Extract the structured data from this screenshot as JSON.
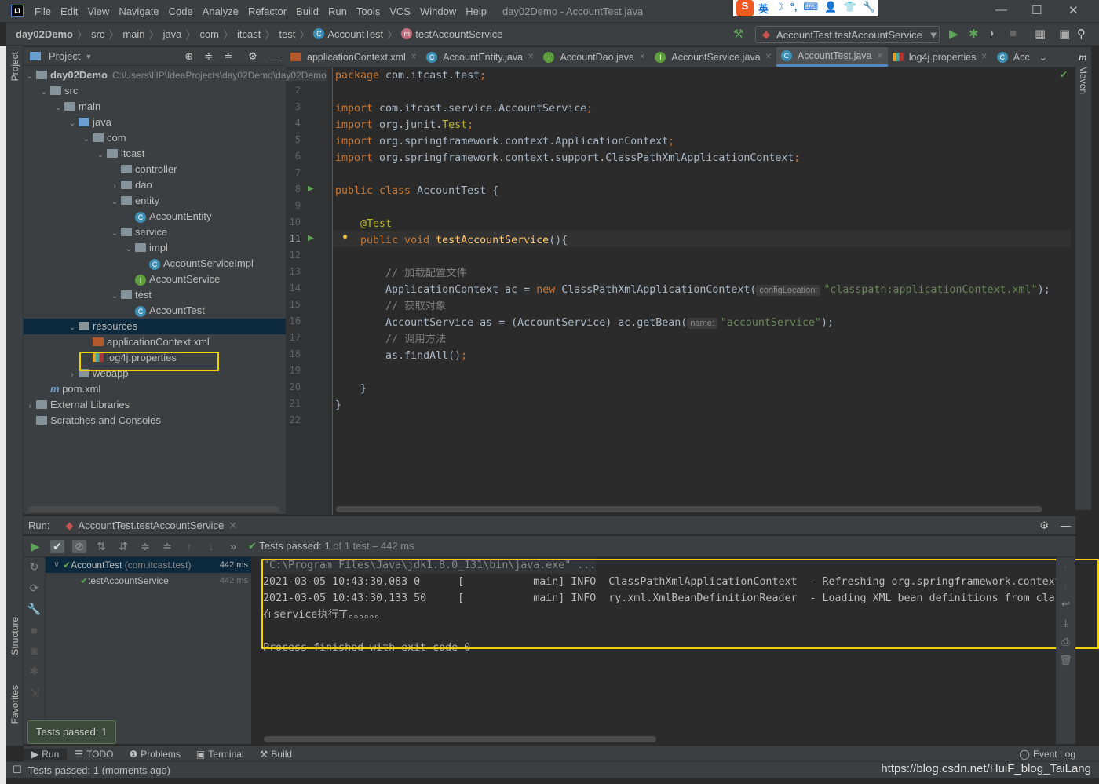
{
  "window": {
    "title": "day02Demo - AccountTest.java",
    "menu": [
      "File",
      "Edit",
      "View",
      "Navigate",
      "Code",
      "Analyze",
      "Refactor",
      "Build",
      "Run",
      "Tools",
      "VCS",
      "Window",
      "Help"
    ],
    "ime": [
      "英",
      "☽",
      "°,",
      "⌨",
      "👤",
      "👕",
      "🔧"
    ]
  },
  "breadcrumb": [
    "day02Demo",
    "src",
    "main",
    "java",
    "com",
    "itcast",
    "test",
    "AccountTest",
    "testAccountService"
  ],
  "run_config": "AccountTest.testAccountService",
  "project": {
    "title": "Project",
    "tree": [
      {
        "label": "day02Demo",
        "path": "C:\\Users\\HP\\IdeaProjects\\day02Demo\\day02Demo",
        "depth": 0,
        "arrow": "v",
        "icon": "module",
        "bold": true
      },
      {
        "label": "src",
        "depth": 1,
        "arrow": "v",
        "icon": "folder"
      },
      {
        "label": "main",
        "depth": 2,
        "arrow": "v",
        "icon": "folder"
      },
      {
        "label": "java",
        "depth": 3,
        "arrow": "v",
        "icon": "source-folder"
      },
      {
        "label": "com",
        "depth": 4,
        "arrow": "v",
        "icon": "package"
      },
      {
        "label": "itcast",
        "depth": 5,
        "arrow": "v",
        "icon": "package"
      },
      {
        "label": "controller",
        "depth": 6,
        "arrow": "",
        "icon": "package"
      },
      {
        "label": "dao",
        "depth": 6,
        "arrow": ">",
        "icon": "package"
      },
      {
        "label": "entity",
        "depth": 6,
        "arrow": "v",
        "icon": "package"
      },
      {
        "label": "AccountEntity",
        "depth": 7,
        "arrow": "",
        "icon": "class"
      },
      {
        "label": "service",
        "depth": 6,
        "arrow": "v",
        "icon": "package"
      },
      {
        "label": "impl",
        "depth": 7,
        "arrow": "v",
        "icon": "package"
      },
      {
        "label": "AccountServiceImpl",
        "depth": 8,
        "arrow": "",
        "icon": "class"
      },
      {
        "label": "AccountService",
        "depth": 7,
        "arrow": "",
        "icon": "interface"
      },
      {
        "label": "test",
        "depth": 6,
        "arrow": "v",
        "icon": "package"
      },
      {
        "label": "AccountTest",
        "depth": 7,
        "arrow": "",
        "icon": "class"
      },
      {
        "label": "resources",
        "depth": 3,
        "arrow": "v",
        "icon": "resources-folder",
        "selected": true
      },
      {
        "label": "applicationContext.xml",
        "depth": 4,
        "arrow": "",
        "icon": "xml"
      },
      {
        "label": "log4j.properties",
        "depth": 4,
        "arrow": "",
        "icon": "properties"
      },
      {
        "label": "webapp",
        "depth": 3,
        "arrow": ">",
        "icon": "folder"
      },
      {
        "label": "pom.xml",
        "depth": 1,
        "arrow": "",
        "icon": "maven"
      },
      {
        "label": "External Libraries",
        "depth": 0,
        "arrow": ">",
        "icon": "libraries"
      },
      {
        "label": "Scratches and Consoles",
        "depth": 0,
        "arrow": "",
        "icon": "scratches"
      }
    ]
  },
  "tabs": [
    {
      "label": "applicationContext.xml",
      "icon": "xml"
    },
    {
      "label": "AccountEntity.java",
      "icon": "class"
    },
    {
      "label": "AccountDao.java",
      "icon": "interface"
    },
    {
      "label": "AccountService.java",
      "icon": "interface"
    },
    {
      "label": "AccountTest.java",
      "icon": "class",
      "active": true
    },
    {
      "label": "log4j.properties",
      "icon": "properties"
    },
    {
      "label": "Acc",
      "icon": "class"
    }
  ],
  "code": [
    [
      [
        "package ",
        "kw"
      ],
      [
        "com.itcast.test",
        ""
      ],
      [
        ";",
        "kw"
      ]
    ],
    [],
    [
      [
        "import ",
        "kw"
      ],
      [
        "com.itcast.service.AccountService",
        ""
      ],
      [
        ";",
        "kw"
      ]
    ],
    [
      [
        "import ",
        "kw"
      ],
      [
        "org.junit.",
        ""
      ],
      [
        "Test",
        "ann"
      ],
      [
        ";",
        "kw"
      ]
    ],
    [
      [
        "import ",
        "kw"
      ],
      [
        "org.springframework.context.ApplicationContext",
        ""
      ],
      [
        ";",
        "kw"
      ]
    ],
    [
      [
        "import ",
        "kw"
      ],
      [
        "org.springframework.context.support.ClassPathXmlApplicationContext",
        ""
      ],
      [
        ";",
        "kw"
      ]
    ],
    [],
    [
      [
        "public class ",
        "kw"
      ],
      [
        "AccountTest {",
        ""
      ]
    ],
    [],
    [
      [
        "    @Test",
        "ann"
      ]
    ],
    [
      [
        "    public void ",
        "kw"
      ],
      [
        "testAccountService",
        "fn"
      ],
      [
        "(){",
        ""
      ]
    ],
    [],
    [
      [
        "        // 加载配置文件",
        "cmt"
      ]
    ],
    [
      [
        "        ApplicationContext ac = ",
        ""
      ],
      [
        "new ",
        "kw"
      ],
      [
        "ClassPathXmlApplicationContext(",
        ""
      ],
      [
        "configLocation:",
        "hint"
      ],
      [
        "\"classpath:applicationContext.xml\"",
        "str"
      ],
      [
        ");",
        ""
      ]
    ],
    [
      [
        "        // 获取对象",
        "cmt"
      ]
    ],
    [
      [
        "        AccountService as = (AccountService) ac.getBean(",
        ""
      ],
      [
        "name:",
        "hint"
      ],
      [
        "\"accountService\"",
        "str"
      ],
      [
        ");",
        ""
      ]
    ],
    [
      [
        "        // 调用方法",
        "cmt"
      ]
    ],
    [
      [
        "        as.findAll()",
        ""
      ],
      [
        ";",
        "kw"
      ]
    ],
    [],
    [
      [
        "    }",
        ""
      ]
    ],
    [
      [
        "}",
        ""
      ]
    ],
    []
  ],
  "current_line": 11,
  "run": {
    "label": "Run:",
    "tab": "AccountTest.testAccountService",
    "status_prefix": "Tests passed:",
    "status_count": "1",
    "status_rest": "of 1 test – 442 ms",
    "tree": [
      {
        "label": "AccountTest",
        "pkg": "(com.itcast.test)",
        "time": "442 ms"
      },
      {
        "label": "testAccountService",
        "time": "442 ms"
      }
    ],
    "console": [
      "\"C:\\Program Files\\Java\\jdk1.8.0_131\\bin\\java.exe\" ...",
      "2021-03-05 10:43:30,083 0      [           main] INFO  ClassPathXmlApplicationContext  - Refreshing org.springframework.context",
      "2021-03-05 10:43:30,133 50     [           main] INFO  ry.xml.XmlBeanDefinitionReader  - Loading XML bean definitions from cla",
      "在service执行了。。。。。。",
      "",
      "Process finished with exit code 0"
    ]
  },
  "tooltip": "Tests passed: 1",
  "bottom_tools": [
    "Run",
    "TODO",
    "Problems",
    "Terminal",
    "Build"
  ],
  "event_log": "Event Log",
  "status": "Tests passed: 1 (moments ago)",
  "side_labels": {
    "project": "Project",
    "structure": "Structure",
    "favorites": "Favorites",
    "maven": "Maven"
  },
  "watermark": "https://blog.csdn.net/HuiF_blog_TaiLang"
}
